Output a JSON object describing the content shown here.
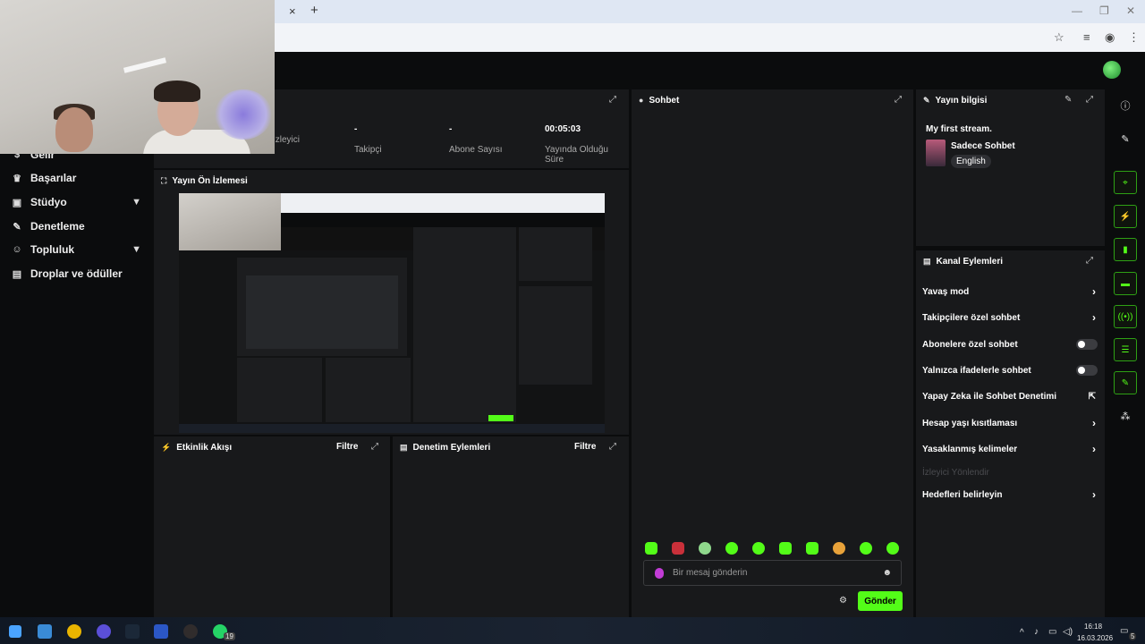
{
  "browser": {
    "close_tab": "×",
    "new_tab": "+",
    "minimize": "—",
    "restore": "❐",
    "close": "✕"
  },
  "sidebar": {
    "items": [
      {
        "label": "Gelir",
        "icon": "dollar-icon"
      },
      {
        "label": "Başarılar",
        "icon": "trophy-icon"
      },
      {
        "label": "Stüdyo",
        "icon": "studio-icon",
        "expandable": true
      },
      {
        "label": "Denetleme",
        "icon": "wrench-icon"
      },
      {
        "label": "Topluluk",
        "icon": "people-icon",
        "expandable": true
      },
      {
        "label": "Droplar ve ödüller",
        "icon": "gift-icon"
      }
    ]
  },
  "stats": [
    {
      "value": "",
      "label": "İzleyici"
    },
    {
      "value": "-",
      "label": "Takipçi"
    },
    {
      "value": "-",
      "label": "Abone Sayısı"
    },
    {
      "value": "00:05:03",
      "label": "Yayında Olduğu Süre"
    }
  ],
  "preview": {
    "title": "Yayın Ön İzlemesi"
  },
  "activity": {
    "title": "Etkinlik Akışı",
    "filter": "Filtre"
  },
  "moderation": {
    "title": "Denetim Eylemleri",
    "filter": "Filtre"
  },
  "chat": {
    "title": "Sohbet",
    "placeholder": "Bir mesaj gönderin",
    "send_label": "Gönder"
  },
  "stream_info": {
    "title": "Yayın bilgisi",
    "stream_title": "My first stream.",
    "category": "Sadece Sohbet",
    "language": "English"
  },
  "channel_actions": {
    "title": "Kanal Eylemleri",
    "items": [
      {
        "label": "Yavaş mod",
        "control": "arrow"
      },
      {
        "label": "Takipçilere özel sohbet",
        "control": "arrow"
      },
      {
        "label": "Abonelere özel sohbet",
        "control": "toggle"
      },
      {
        "label": "Yalnızca ifadelerle sohbet",
        "control": "toggle"
      },
      {
        "label": "Yapay Zeka ile Sohbet Denetimi",
        "control": "external"
      },
      {
        "label": "Hesap yaşı kısıtlaması",
        "control": "arrow"
      },
      {
        "label": "Yasaklanmış kelimeler",
        "control": "arrow"
      },
      {
        "label": "İzleyici Yönlendir",
        "control": "none",
        "disabled": true
      },
      {
        "label": "Hedefleri belirleyin",
        "control": "arrow"
      }
    ]
  },
  "colors": {
    "accent": "#53fc18",
    "panel": "#18191b",
    "background": "#0b0c0d"
  },
  "taskbar": {
    "time": "16:18",
    "date": "16.03.2026",
    "badge": "19",
    "notif": "5"
  }
}
